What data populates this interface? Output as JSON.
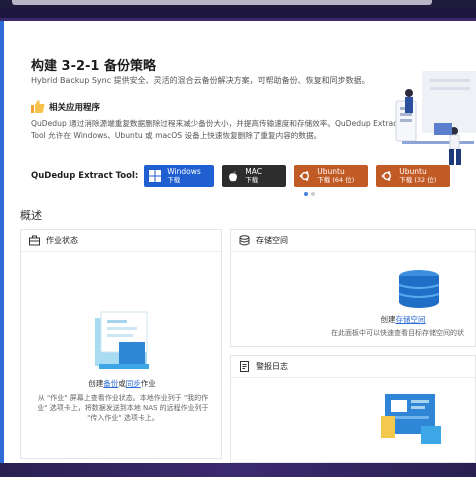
{
  "banner": {
    "title": "构建 3-2-1 备份策略",
    "description": "Hybrid Backup Sync 提供安全、灵活的混合云备份解决方案，可帮助备份、恢复和同步数据。",
    "apps_label": "相关应用程序",
    "apps_description": "QuDedup 通过消除源端重复数据删除过程来减少备份大小，并提高传输速度和存储效率。QuDedup Extract Tool 允许在 Windows、Ubuntu 或 macOS 设备上快速恢复删除了重复内容的数据。",
    "tool_label": "QuDedup Extract Tool:",
    "buttons": [
      {
        "label": "Windows",
        "sub": "下载",
        "icon": "windows-icon"
      },
      {
        "label": "MAC",
        "sub": "下载",
        "icon": "apple-icon"
      },
      {
        "label": "Ubuntu",
        "sub": "下载 (64 位)",
        "icon": "ubuntu-icon"
      },
      {
        "label": "Ubuntu",
        "sub": "下载 (32 位)",
        "icon": "ubuntu-icon"
      }
    ],
    "carousel_active": 0
  },
  "overview": {
    "title": "概述",
    "jobs": {
      "header": "作业状态",
      "create_prefix": "创建",
      "link_backup": "备份",
      "link_or": "或",
      "link_sync": "同步",
      "create_suffix": "作业",
      "description": "从 \"作业\" 屏幕上查看作业状态。本地作业列于 \"我的作业\" 选项卡上，将数据发送到本地 NAS 的远程作业列于 \"传入作业\" 选项卡上。"
    },
    "storage": {
      "header": "存储空间",
      "create_prefix": "创建",
      "link": "存储空间",
      "description": "在此面板中可以快速查看目标存储空间的状"
    },
    "logs": {
      "header": "警报日志"
    }
  },
  "colors": {
    "accent": "#2d6bd6",
    "windows": "#1f5fd1",
    "mac": "#2d2d2d",
    "ubuntu": "#c25a25"
  }
}
